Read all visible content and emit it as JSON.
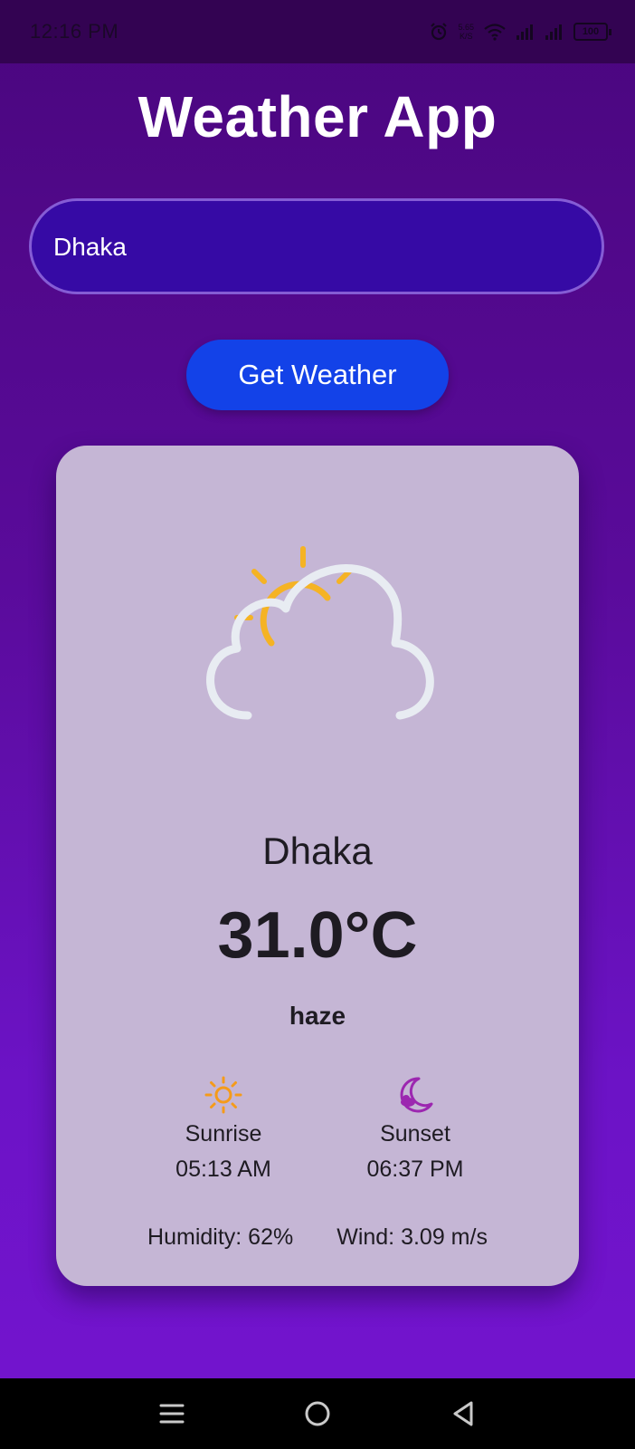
{
  "status_bar": {
    "time": "12:16 PM",
    "net_speed_value": "5.65",
    "net_speed_unit": "K/S",
    "battery": "100",
    "icons": [
      "alarm-icon",
      "wifi-icon",
      "signal-icon",
      "signal-icon",
      "battery-icon"
    ]
  },
  "header": {
    "title": "Weather App"
  },
  "search": {
    "value": "Dhaka",
    "placeholder": ""
  },
  "actions": {
    "get_weather_label": "Get Weather"
  },
  "weather": {
    "icon": "partly-cloudy-icon",
    "city": "Dhaka",
    "temperature": "31.0°C",
    "condition": "haze",
    "sunrise_label": "Sunrise",
    "sunrise_time": "05:13 AM",
    "sunset_label": "Sunset",
    "sunset_time": "06:37 PM",
    "humidity": "Humidity: 62%",
    "wind": "Wind: 3.09 m/s"
  },
  "nav_bar": {
    "icons": [
      "menu-icon",
      "home-icon",
      "back-icon"
    ]
  },
  "colors": {
    "accent": "#1342e8",
    "sun": "#f5b324",
    "sunrise_icon": "#f59b1a",
    "sunset_icon": "#9c27b0",
    "card_bg": "#c5b6d5"
  }
}
